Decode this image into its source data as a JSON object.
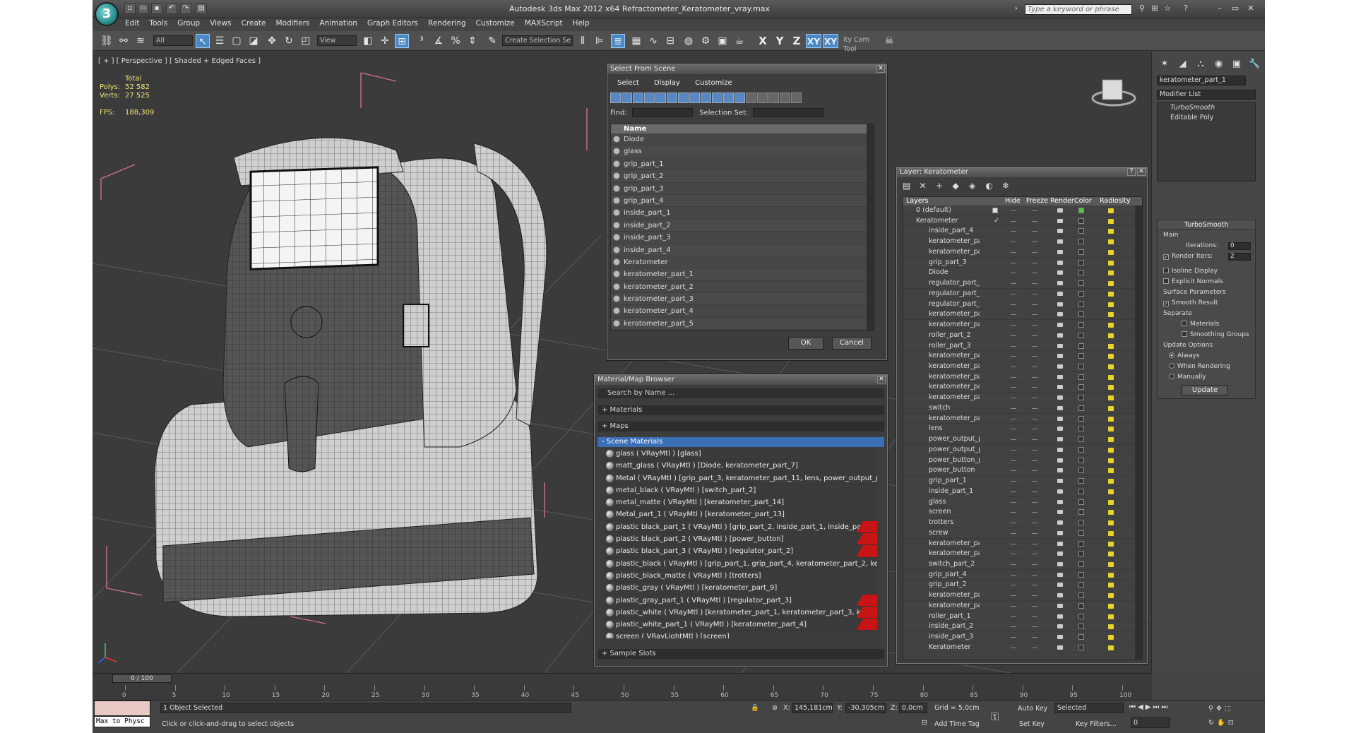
{
  "titlebar": {
    "app_title": "Autodesk 3ds Max  2012 x64     Refractometer_Keratometer_vray.max",
    "search_placeholder": "Type a keyword or phrase"
  },
  "menu": [
    "Edit",
    "Tools",
    "Group",
    "Views",
    "Create",
    "Modifiers",
    "Animation",
    "Graph Editors",
    "Rendering",
    "Customize",
    "MAXScript",
    "Help"
  ],
  "toolbar": {
    "selection_filter": "All",
    "ref_coord": "View",
    "named_selection": "Create Selection Se",
    "axes": [
      "X",
      "Y",
      "Z",
      "XY",
      "XY"
    ],
    "cam_tool": "ity Cam Tool"
  },
  "viewport": {
    "label": "[ + ] [ Perspective ] [ Shaded + Edged Faces ]",
    "stats_header": "Total",
    "polys_label": "Polys:",
    "polys": "52 582",
    "verts_label": "Verts:",
    "verts": "27 525",
    "fps_label": "FPS:",
    "fps": "188,309"
  },
  "select_from_scene": {
    "title": "Select From Scene",
    "menu": [
      "Select",
      "Display",
      "Customize"
    ],
    "find_label": "Find:",
    "selection_set_label": "Selection Set:",
    "column": "Name",
    "items": [
      "Diode",
      "glass",
      "grip_part_1",
      "grip_part_2",
      "grip_part_3",
      "grip_part_4",
      "inside_part_1",
      "inside_part_2",
      "inside_part_3",
      "inside_part_4",
      "Keratometer",
      "keratometer_part_1",
      "keratometer_part_2",
      "keratometer_part_3",
      "keratometer_part_4",
      "keratometer_part_5"
    ],
    "ok": "OK",
    "cancel": "Cancel"
  },
  "material_browser": {
    "title": "Material/Map Browser",
    "search_placeholder": "Search by Name ...",
    "groups": [
      "+ Materials",
      "+ Maps",
      "- Scene Materials",
      "+ Sample Slots"
    ],
    "materials": [
      {
        "text": "glass  ( VRayMtl )  [glass]",
        "flag": false
      },
      {
        "text": "matt_glass  ( VRayMtl )  [Diode, keratometer_part_7]",
        "flag": false
      },
      {
        "text": "Metal  ( VRayMtl )  [grip_part_3, keratometer_part_11, lens, power_output_part_...",
        "flag": false
      },
      {
        "text": "metal_black  ( VRayMtl )  [switch_part_2]",
        "flag": false
      },
      {
        "text": "metal_matte  ( VRayMtl )  [keratometer_part_14]",
        "flag": false
      },
      {
        "text": "Metal_part_1  ( VRayMtl )  [keratometer_part_13]",
        "flag": false
      },
      {
        "text": "plastic black_part_1  ( VRayMtl )  [grip_part_2, inside_part_1, inside_part_2, insi...",
        "flag": true
      },
      {
        "text": "plastic black_part_2  ( VRayMtl )  [power_button]",
        "flag": true
      },
      {
        "text": "plastic black_part_3  ( VRayMtl )  [regulator_part_2]",
        "flag": true
      },
      {
        "text": "plastic_black  ( VRayMtl )  [grip_part_1, grip_part_4, keratometer_part_2, kerato...",
        "flag": false
      },
      {
        "text": "plastic_black_matte  ( VRayMtl )  [trotters]",
        "flag": false
      },
      {
        "text": "plastic_gray  ( VRayMtl )  [keratometer_part_9]",
        "flag": false
      },
      {
        "text": "plastic_gray_part_1  ( VRayMtl )  [regulator_part_3]",
        "flag": true
      },
      {
        "text": "plastic_white  ( VRayMtl )  [keratometer_part_1, keratometer_part_3, keratomet...",
        "flag": true
      },
      {
        "text": "plastic_white_part_1  ( VRayMtl )  [keratometer_part_4]",
        "flag": true
      },
      {
        "text": "screen  ( VRayLightMtl )  [screen]",
        "flag": false
      }
    ]
  },
  "layer_manager": {
    "title": "Layer: Keratometer",
    "columns": [
      "Layers",
      "Hide",
      "Freeze",
      "Render",
      "Color",
      "Radiosity"
    ],
    "top_layers": [
      "0 (default)",
      "Keratometer"
    ],
    "items": [
      "inside_part_4",
      "keratometer_par",
      "keratometer_par",
      "grip_part_3",
      "Diode",
      "regulator_part_",
      "regulator_part_",
      "regulator_part_",
      "keratometer_par",
      "keratometer_par",
      "roller_part_2",
      "roller_part_3",
      "keratometer_par",
      "keratometer_par",
      "keratometer_par",
      "keratometer_par",
      "keratometer_par",
      "switch",
      "keratometer_par",
      "lens",
      "power_output_p",
      "power_output_p",
      "power_button_p",
      "power_button",
      "grip_part_1",
      "inside_part_1",
      "glass",
      "screen",
      "trotters",
      "screw",
      "keratometer_par",
      "keratometer_par",
      "switch_part_2",
      "grip_part_4",
      "grip_part_2",
      "keratometer_par",
      "keratometer_par",
      "roller_part_1",
      "inside_part_2",
      "inside_part_3",
      "Keratometer"
    ]
  },
  "command_panel": {
    "object_name": "keratometer_part_1",
    "modifier_list": "Modifier List",
    "stack": [
      "TurboSmooth",
      "Editable Poly"
    ],
    "turbosmooth_title": "TurboSmooth",
    "main_label": "Main",
    "iterations_label": "Iterations:",
    "iterations": "0",
    "render_iters_label": "Render Iters:",
    "render_iters": "2",
    "isoline": "Isoline Display",
    "explicit_normals": "Explicit Normals",
    "surface_params": "Surface Parameters",
    "smooth_result": "Smooth Result",
    "separate": "Separate",
    "materials": "Materials",
    "smoothing_groups": "Smoothing Groups",
    "update_options": "Update Options",
    "always": "Always",
    "when_rendering": "When Rendering",
    "manually": "Manually",
    "update": "Update"
  },
  "timeline": {
    "slider": "0 / 100",
    "ticks": [
      "0",
      "5",
      "10",
      "15",
      "20",
      "25",
      "30",
      "35",
      "40",
      "45",
      "50",
      "55",
      "60",
      "65",
      "70",
      "75",
      "80",
      "85",
      "90",
      "95",
      "100"
    ]
  },
  "status": {
    "maxscript": "Max to Physc",
    "selected": "1 Object Selected",
    "prompt": "Click or click-and-drag to select objects",
    "x_label": "X:",
    "x": "145,181cm",
    "y_label": "Y:",
    "y": "-30,305cm",
    "z_label": "Z:",
    "z": "0,0cm",
    "grid": "Grid = 5,0cm",
    "add_time_tag": "Add Time Tag",
    "auto_key": "Auto Key",
    "auto_key_mode": "Selected",
    "set_key": "Set Key",
    "key_filters": "Key Filters...",
    "frame": "0"
  }
}
